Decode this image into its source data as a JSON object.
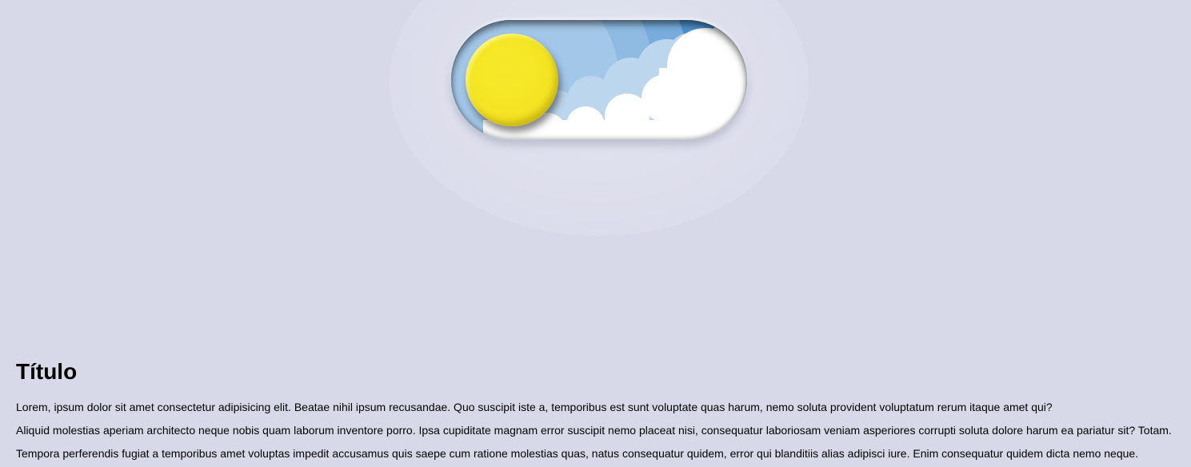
{
  "toggle": {
    "state": "day",
    "checked": false,
    "knob_icon": "sun-icon",
    "scene_icon": "clouds-icon",
    "colors": {
      "sky": "#6b9fd6",
      "sun": "#f4e423",
      "cloud": "#ffffff"
    }
  },
  "content": {
    "title": "Título",
    "paragraphs": [
      "Lorem, ipsum dolor sit amet consectetur adipisicing elit. Beatae nihil ipsum recusandae. Quo suscipit iste a, temporibus est sunt voluptate quas harum, nemo soluta provident voluptatum rerum itaque amet qui?",
      "Aliquid molestias aperiam architecto neque nobis quam laborum inventore porro. Ipsa cupiditate magnam error suscipit nemo placeat nisi, consequatur laboriosam veniam asperiores corrupti soluta dolore harum ea pariatur sit? Totam.",
      "Tempora perferendis fugiat a temporibus amet voluptas impedit accusamus quis saepe cum ratione molestias quas, natus consequatur quidem, error qui blanditiis alias adipisci iure. Enim consequatur quidem dicta nemo neque."
    ]
  }
}
